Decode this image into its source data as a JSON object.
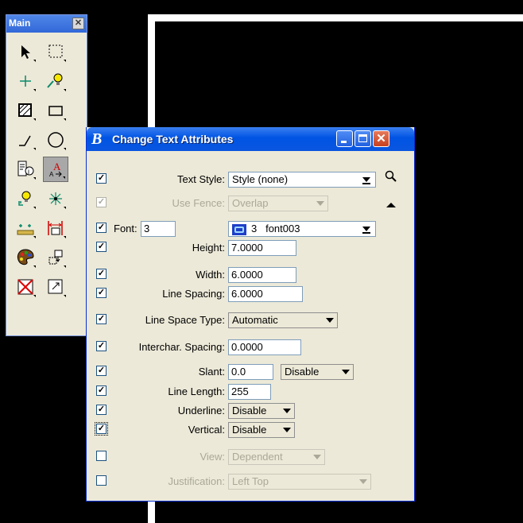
{
  "main_palette": {
    "title": "Main",
    "close_glyph": "✕",
    "tools": [
      {
        "name": "element-selection-icon",
        "active": false
      },
      {
        "name": "fence-block-icon",
        "active": false
      },
      {
        "name": "tentative-point-icon",
        "active": false
      },
      {
        "name": "lightbulb-info-icon",
        "active": false
      },
      {
        "name": "hatch-area-icon",
        "active": false
      },
      {
        "name": "rectangle-icon",
        "active": false
      },
      {
        "name": "line-icon",
        "active": false
      },
      {
        "name": "circle-icon",
        "active": false
      },
      {
        "name": "element-info-icon",
        "active": false
      },
      {
        "name": "text-tool-icon",
        "active": true
      },
      {
        "name": "lightbulb-cell-icon",
        "active": false
      },
      {
        "name": "point-star-icon",
        "active": false
      },
      {
        "name": "measure-distance-icon",
        "active": false
      },
      {
        "name": "dimension-icon",
        "active": false
      },
      {
        "name": "palette-icon",
        "active": false
      },
      {
        "name": "move-copy-icon",
        "active": false
      },
      {
        "name": "delete-icon",
        "active": false
      },
      {
        "name": "scale-icon",
        "active": false
      }
    ]
  },
  "dialog": {
    "title": "Change Text Attributes",
    "title_logo": "B",
    "rows": {
      "text_style": {
        "label": "Text Style:",
        "value": "Style (none)",
        "checked": true
      },
      "use_fence": {
        "label": "Use Fence:",
        "value": "Overlap",
        "checked": true,
        "disabled": true
      },
      "font": {
        "label": "Font:",
        "number": "3",
        "value_num": "3",
        "value_name": "font003",
        "checked": true
      },
      "height": {
        "label": "Height:",
        "value": "7.0000",
        "checked": true
      },
      "width": {
        "label": "Width:",
        "value": "6.0000",
        "checked": true
      },
      "line_spacing": {
        "label": "Line Spacing:",
        "value": "6.0000",
        "checked": true
      },
      "line_space_type": {
        "label": "Line Space Type:",
        "value": "Automatic",
        "checked": true
      },
      "interchar_spacing": {
        "label": "Interchar. Spacing:",
        "value": "0.0000",
        "checked": true
      },
      "slant": {
        "label": "Slant:",
        "value": "0.0",
        "option": "Disable",
        "checked": true
      },
      "line_length": {
        "label": "Line Length:",
        "value": "255",
        "checked": true
      },
      "underline": {
        "label": "Underline:",
        "value": "Disable",
        "checked": true
      },
      "vertical": {
        "label": "Vertical:",
        "value": "Disable",
        "checked": true
      },
      "view": {
        "label": "View:",
        "value": "Dependent",
        "checked": false,
        "disabled": true
      },
      "justification": {
        "label": "Justification:",
        "value": "Left Top",
        "checked": false,
        "disabled": true
      }
    }
  }
}
